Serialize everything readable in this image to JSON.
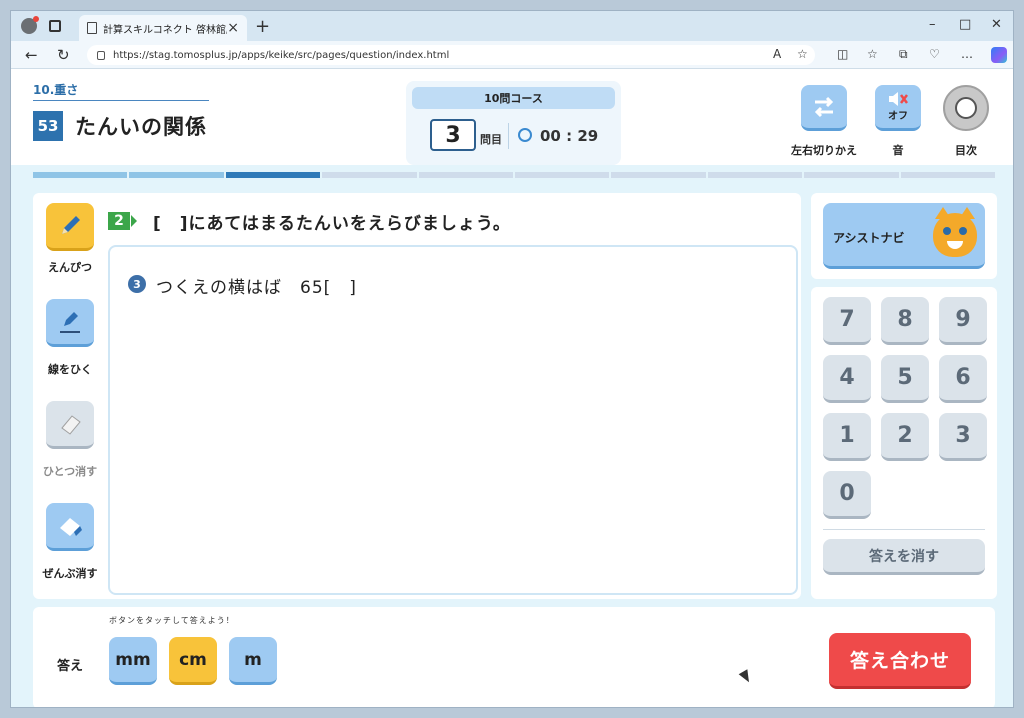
{
  "browser": {
    "tab_title": "計算スキルコネクト 啓林館版",
    "url": "https://stag.tomosplus.jp/apps/keike/src/pages/question/index.html",
    "new_tab": "+",
    "tab_close": "×",
    "window_controls": {
      "minimize": "–",
      "maximize": "□",
      "close": "✕"
    }
  },
  "header": {
    "unit_label": "10.重さ",
    "lesson_number": "53",
    "lesson_title": "たんいの関係",
    "course_title": "10問コース",
    "question_number": "3",
    "question_suffix": "問目",
    "timer": "00 : 29",
    "buttons": {
      "lr_switch": "左右切りかえ",
      "sound_state": "オフ",
      "sound": "音",
      "toc": "目次"
    }
  },
  "progress": {
    "total": 10,
    "current": 3
  },
  "tools": {
    "pencil": "えんぴつ",
    "line": "線をひく",
    "erase_one": "ひとつ消す",
    "erase_all": "ぜんぶ消す"
  },
  "question": {
    "number": "2",
    "instruction": "[　]にあてはまるたんいをえらびましょう。",
    "sub_number": "3",
    "sub_text": "つくえの横はば　65[　]"
  },
  "assist": {
    "label": "アシストナビ"
  },
  "keypad": {
    "keys": [
      "7",
      "8",
      "9",
      "4",
      "5",
      "6",
      "1",
      "2",
      "3",
      "0"
    ],
    "clear_label": "答えを消す"
  },
  "answer": {
    "hint": "ボタンをタッチして答えよう！",
    "label": "答え",
    "units": [
      "mm",
      "cm",
      "m"
    ],
    "submit_label": "答え合わせ"
  },
  "colors": {
    "primary_blue": "#9ecaf2",
    "selected_yellow": "#f8c33a",
    "submit_red": "#ef4a4a",
    "lesson_badge": "#2d72ae",
    "question_green": "#3ca64a"
  }
}
